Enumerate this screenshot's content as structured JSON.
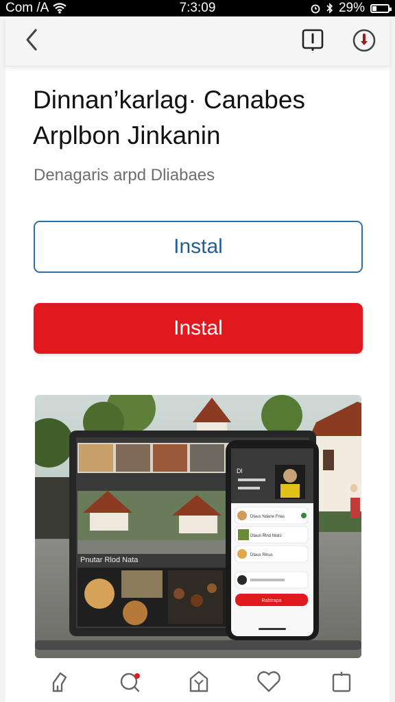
{
  "status_bar": {
    "carrier": "Com /A",
    "time": "7:3:09",
    "battery": "29%",
    "battery_level": 0.29
  },
  "header": {
    "back_icon": "chevron-left-icon",
    "alert_icon": "alert-box-icon",
    "download_icon": "download-circle-icon",
    "accent": "#e0191f"
  },
  "app": {
    "title": "Dinnan’karlag· Canabes Arplbon Jinkanin",
    "subtitle": "Denagaris arpd Dliabaes",
    "install_outline_label": "Instal",
    "install_primary_label": "Instal"
  },
  "screenshot": {
    "laptop_caption": "Pnutar Rlod Nata",
    "phone_header": "Dl",
    "phone_button": "Rabtrapa",
    "phone_items": [
      "Dtaus Ndane Frlas",
      "Dtaun Rlnd Ntats",
      "Dtaus Rlnus"
    ]
  },
  "tab_bar": {
    "items": [
      "home-icon",
      "search-icon",
      "store-icon",
      "heart-icon",
      "bag-icon"
    ],
    "notification_color": "#e0191f"
  }
}
